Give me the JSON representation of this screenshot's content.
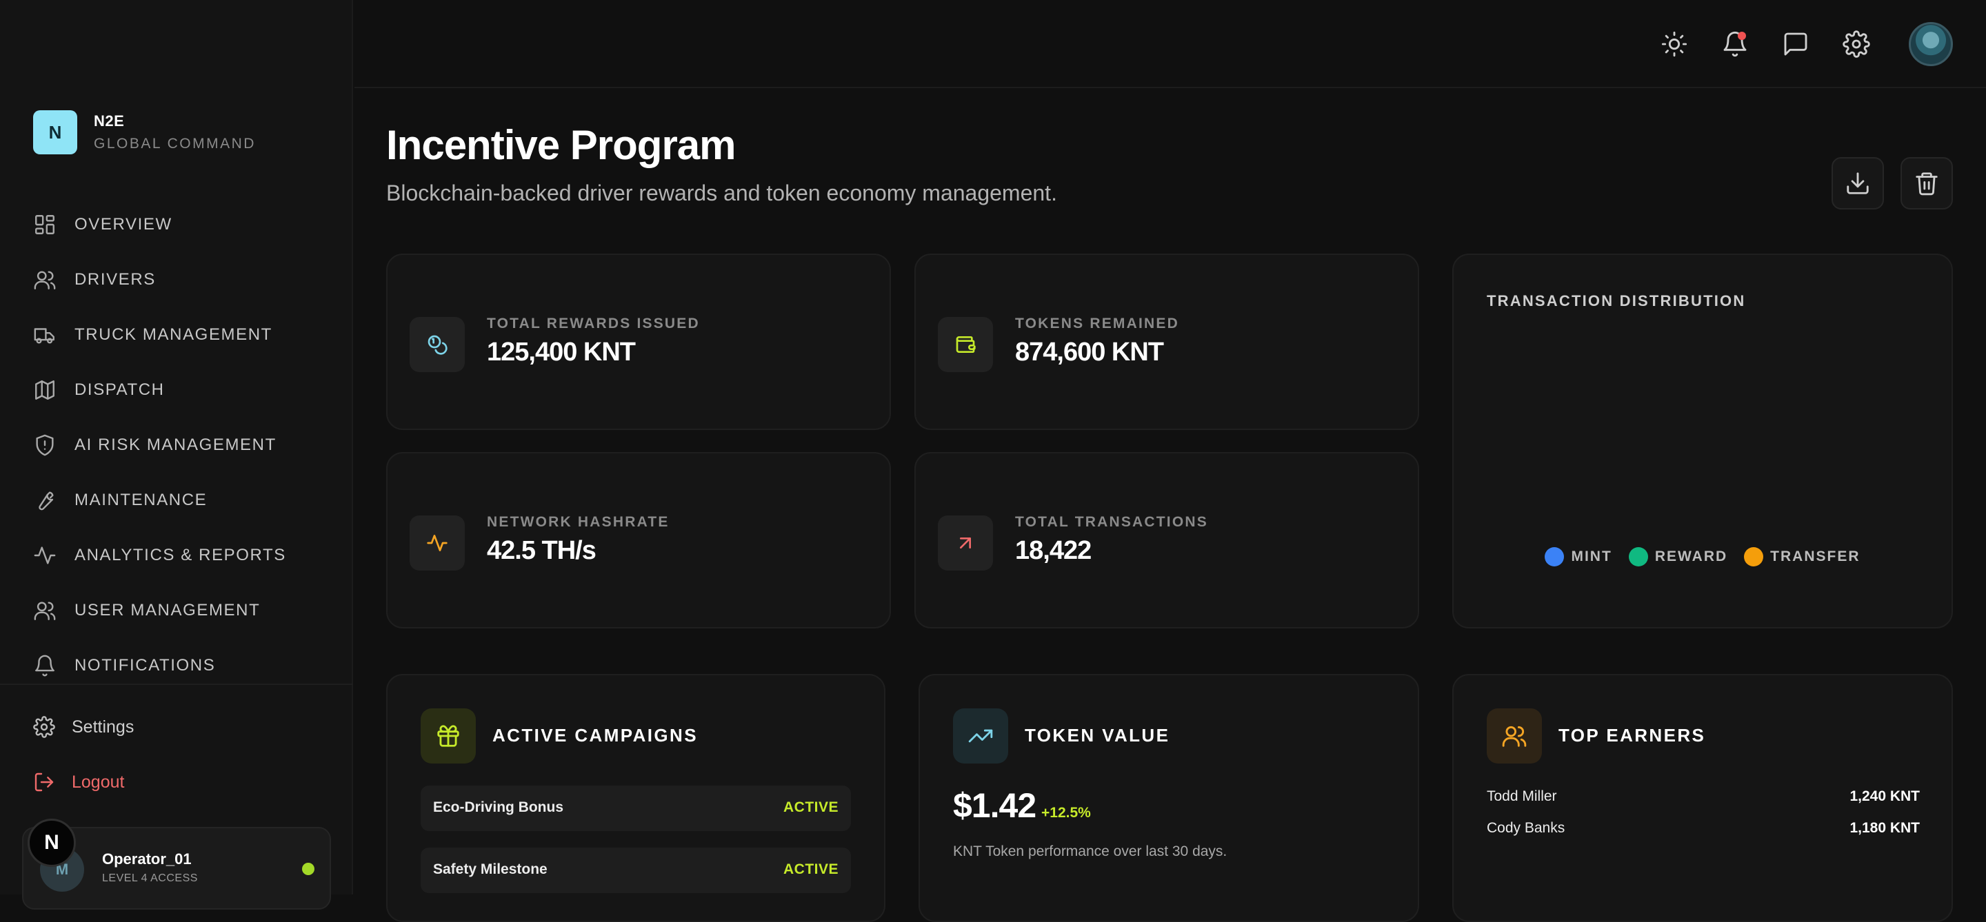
{
  "brand": {
    "logo_letter": "N",
    "name": "N2E",
    "subtitle": "GLOBAL COMMAND"
  },
  "sidebar": {
    "items": [
      {
        "label": "OVERVIEW",
        "icon": "dashboard-icon"
      },
      {
        "label": "DRIVERS",
        "icon": "users-icon"
      },
      {
        "label": "TRUCK MANAGEMENT",
        "icon": "truck-icon"
      },
      {
        "label": "DISPATCH",
        "icon": "map-icon"
      },
      {
        "label": "AI RISK MANAGEMENT",
        "icon": "shield-alert-icon"
      },
      {
        "label": "MAINTENANCE",
        "icon": "wrench-icon"
      },
      {
        "label": "ANALYTICS & REPORTS",
        "icon": "activity-icon"
      },
      {
        "label": "USER MANAGEMENT",
        "icon": "users-icon"
      },
      {
        "label": "NOTIFICATIONS",
        "icon": "bell-icon"
      }
    ],
    "settings_label": "Settings",
    "logout_label": "Logout",
    "user": {
      "avatar_initial": "M",
      "name": "Operator_01",
      "role": "LEVEL 4 ACCESS",
      "status_color": "#a3d928"
    },
    "floating_badge": "N"
  },
  "topbar": {
    "icons": [
      "sun-icon",
      "bell-icon",
      "message-icon",
      "gear-icon",
      "avatar"
    ],
    "notification_dot_color": "#f05252"
  },
  "page": {
    "title": "Incentive Program",
    "subtitle": "Blockchain-backed driver rewards and token economy management.",
    "actions": [
      "download-icon",
      "trash-icon"
    ]
  },
  "stats": [
    {
      "label": "TOTAL REWARDS ISSUED",
      "value": "125,400 KNT",
      "icon": "coins-icon",
      "color": "#7dd3e8"
    },
    {
      "label": "TOKENS REMAINED",
      "value": "874,600 KNT",
      "icon": "wallet-icon",
      "color": "#c6ea2a"
    },
    {
      "label": "NETWORK HASHRATE",
      "value": "42.5 TH/s",
      "icon": "activity-icon",
      "color": "#f5a524"
    },
    {
      "label": "TOTAL TRANSACTIONS",
      "value": "18,422",
      "icon": "arrow-up-right-icon",
      "color": "#f06a6a"
    }
  ],
  "distribution": {
    "title": "TRANSACTION DISTRIBUTION",
    "legend": [
      {
        "label": "MINT",
        "color": "#3b82f6"
      },
      {
        "label": "REWARD",
        "color": "#10b981"
      },
      {
        "label": "TRANSFER",
        "color": "#f59e0b"
      }
    ]
  },
  "campaigns": {
    "title": "ACTIVE CAMPAIGNS",
    "icon": "gift-icon",
    "items": [
      {
        "name": "Eco-Driving Bonus",
        "status": "ACTIVE"
      },
      {
        "name": "Safety Milestone",
        "status": "ACTIVE"
      }
    ]
  },
  "token": {
    "title": "TOKEN VALUE",
    "icon": "trending-up-icon",
    "price": "$1.42",
    "change": "+12.5%",
    "description": "KNT Token performance over last 30 days."
  },
  "earners": {
    "title": "TOP EARNERS",
    "icon": "users-icon",
    "items": [
      {
        "name": "Todd Miller",
        "amount": "1,240 KNT"
      },
      {
        "name": "Cody Banks",
        "amount": "1,180 KNT"
      }
    ]
  }
}
